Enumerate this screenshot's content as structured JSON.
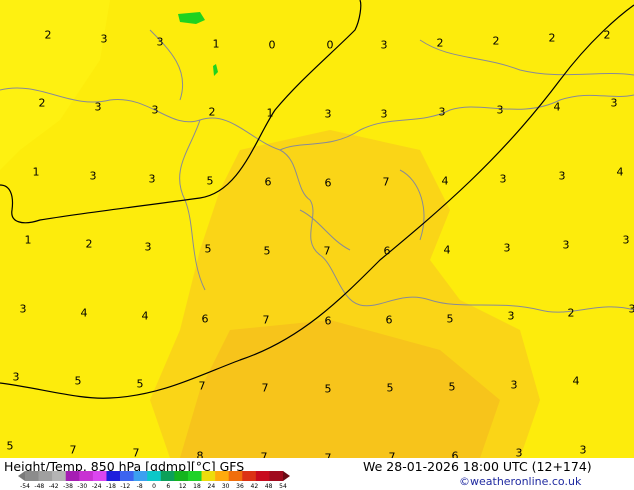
{
  "map": {
    "background_color": "#fdec0c",
    "warm_color": "#f9d11a",
    "warmer_color": "#f6c21c",
    "cool_color": "#fef414",
    "contour_color": "#000000",
    "border_color": "#888a97",
    "green_color": "#1fd21f",
    "grid_values": [
      "2",
      "3",
      "3",
      "1",
      "0",
      "0",
      "3",
      "2",
      "2",
      "2",
      "2",
      "2",
      "3",
      "3",
      "2",
      "1",
      "3",
      "3",
      "3",
      "3",
      "4",
      "3",
      "1",
      "3",
      "3",
      "5",
      "6",
      "6",
      "7",
      "4",
      "3",
      "3",
      "4",
      "1",
      "2",
      "3",
      "5",
      "5",
      "7",
      "6",
      "4",
      "3",
      "3",
      "3",
      "3",
      "4",
      "4",
      "6",
      "7",
      "6",
      "6",
      "5",
      "3",
      "2",
      "3",
      "3",
      "5",
      "5",
      "7",
      "7",
      "5",
      "5",
      "5",
      "3",
      "4",
      "5",
      "7",
      "7",
      "8",
      "7",
      "7",
      "7",
      "6",
      "3",
      "3"
    ]
  },
  "footer": {
    "title": "Height/Temp. 850 hPa [gdmp][°C] GFS",
    "datetime": "We 28-01-2026 18:00 UTC (12+174)",
    "credit": "©weatheronline.co.uk",
    "legend_ticks": [
      "-54",
      "-48",
      "-42",
      "-38",
      "-30",
      "-24",
      "-18",
      "-12",
      "-8",
      "0",
      "6",
      "12",
      "18",
      "24",
      "30",
      "36",
      "42",
      "48",
      "54"
    ],
    "legend_colors": [
      "#8c8c8c",
      "#a0a0a0",
      "#b4b4b4",
      "#a61eb4",
      "#c832d2",
      "#dc46f0",
      "#1e1edc",
      "#3c64f0",
      "#3ca0f0",
      "#0cc8c8",
      "#0ca05a",
      "#14b41e",
      "#1ed228",
      "#eedc0c",
      "#ffaa0c",
      "#f06e0c",
      "#dc3214",
      "#c80a1e",
      "#a00a1e"
    ]
  }
}
